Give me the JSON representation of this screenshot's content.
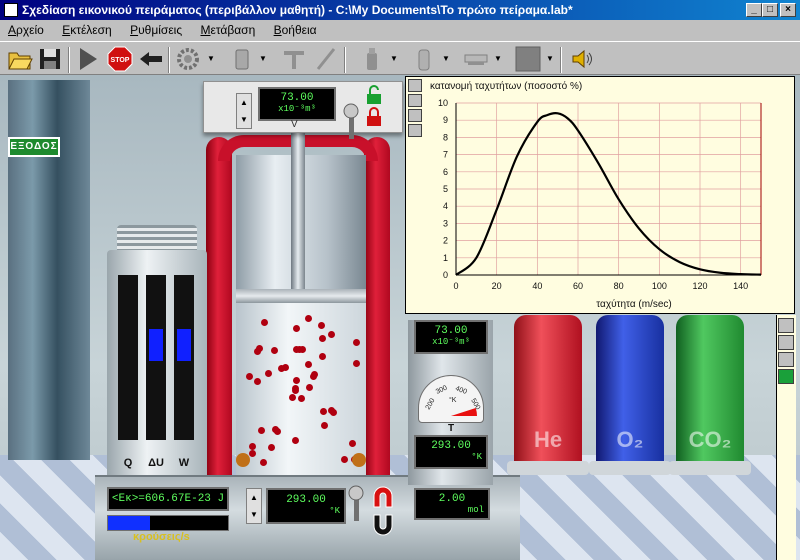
{
  "window": {
    "title": "Σχεδίαση εικονικού πειράματος (περιβάλλον μαθητή) - C:\\My Documents\\Το πρώτο πείραμα.lab*",
    "min_label": "_",
    "max_label": "□",
    "close_label": "×"
  },
  "menu": {
    "items": [
      {
        "underline": "Α",
        "rest": "ρχείο"
      },
      {
        "underline": "Ε",
        "rest": "κτέλεση"
      },
      {
        "underline": "Ρ",
        "rest": "υθμίσεις"
      },
      {
        "underline": "Μ",
        "rest": "ετάβαση"
      },
      {
        "underline": "Β",
        "rest": "οήθεια"
      }
    ]
  },
  "toolbar": {
    "icons": [
      "open-folder-icon",
      "save-icon",
      "play-icon",
      "stop-icon",
      "back-arrow-icon",
      "gear-icon",
      "beaker-icon",
      "tool-t-icon",
      "rod-icon",
      "bottle-icon",
      "cylinder-icon",
      "plate-icon",
      "color-square-icon",
      "speaker-icon"
    ],
    "stop_text": "STOP"
  },
  "scene": {
    "exit_sign": "ΕΞΟΔΟΣ",
    "volume_display": {
      "value": "73.00",
      "unit": "x10⁻³m³",
      "label": "V"
    },
    "energy_labels": [
      "Q",
      "ΔU",
      "W"
    ],
    "energy_fills": [
      0,
      0.18,
      0.18
    ],
    "kinetic_energy": "<Εκ>=606.67E-23 J",
    "collisions_label": "κρούσεις/s",
    "collisions_fill": 0.35,
    "temperature_left": {
      "value": "293.00",
      "unit": "°K"
    },
    "moles": {
      "value": "2.00",
      "unit": "mol"
    },
    "stand_volume": {
      "value": "73.00",
      "unit": "x10⁻³m³"
    },
    "stand_temp": {
      "value": "293.00",
      "unit": "°K"
    },
    "gauge": {
      "ticks": [
        "200",
        "300",
        "400",
        "500"
      ],
      "unit": "°K",
      "label": "T",
      "reading_fraction": 0.9
    },
    "tanks": [
      {
        "label": "He",
        "color": "#d82030"
      },
      {
        "label": "O₂",
        "color": "#2038c8"
      },
      {
        "label": "CO₂",
        "color": "#2aa83a"
      }
    ],
    "particle_count": 44
  },
  "chart_data": {
    "type": "line",
    "title": "κατανομή ταχυτήτων (ποσοστό %)",
    "xlabel": "ταχύτητα (m/sec)",
    "ylabel": "",
    "xlim": [
      0,
      150
    ],
    "ylim": [
      0,
      10
    ],
    "xticks": [
      0,
      20,
      40,
      60,
      80,
      100,
      120,
      140
    ],
    "yticks": [
      0,
      1,
      2,
      3,
      4,
      5,
      6,
      7,
      8,
      9,
      10
    ],
    "grid": true,
    "series": [
      {
        "x": [
          0,
          10,
          20,
          30,
          40,
          45,
          50,
          55,
          60,
          70,
          80,
          90,
          100,
          110,
          120,
          130,
          140,
          150
        ],
        "values": [
          0,
          1.0,
          3.8,
          6.9,
          8.9,
          9.3,
          9.4,
          9.1,
          8.4,
          6.5,
          4.4,
          2.7,
          1.5,
          0.75,
          0.33,
          0.13,
          0.05,
          0.02
        ]
      }
    ]
  }
}
